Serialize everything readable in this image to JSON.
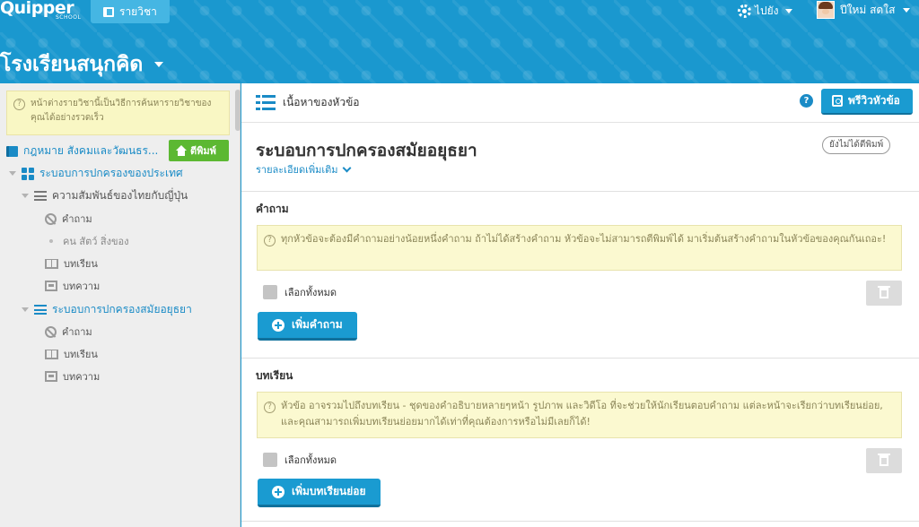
{
  "topnav": {
    "logo": "Quipper",
    "logo_sub": "SCHOOL",
    "subjects_label": "รายวิชา",
    "goto_label": "ไปยัง",
    "user_name": "ปีใหม่ สดใส"
  },
  "school": {
    "name": "โรงเรียนสนุกคิด"
  },
  "sidebar": {
    "notice": "หน้าต่างรายวิชานี้เป็นวิธีการค้นหารายวิชาของคุณได้อย่างรวดเร็ว",
    "course_title": "กฎหมาย สังคมและวัฒนธร...",
    "print_label": "ตีพิมพ์",
    "tree": {
      "chapter": "ระบอบการปกครองของประเทศ",
      "topic1": {
        "label": "ความสัมพันธ์ของไทยกับญี่ปุ่น",
        "items": [
          "คำถาม",
          "คน สัตว์ สิ่งของ",
          "บทเรียน",
          "บทความ"
        ]
      },
      "topic2": {
        "label": "ระบอบการปกครองสมัยอยุธยา",
        "items": [
          "คำถาม",
          "บทเรียน",
          "บทความ"
        ]
      }
    }
  },
  "main": {
    "toolbar_label": "เนื้อหาของหัวข้อ",
    "help_label": "?",
    "preview_label": "พรีวิวหัวข้อ",
    "topic_title": "ระบอบการปกครองสมัยอยุธยา",
    "status_badge": "ยังไม่ได้ตีพิมพ์",
    "more_details": "รายละเอียดเพิ่มเติม",
    "questions": {
      "title": "คำถาม",
      "info": "ทุกหัวข้อจะต้องมีคำถามอย่างน้อยหนึ่งคำถาม ถ้าไม่ได้สร้างคำถาม หัวข้อจะไม่สามารถตีพิมพ์ได้ มาเริ่มต้นสร้างคำถามในหัวข้อของคุณกันเถอะ!",
      "select_all": "เลือกทั้งหมด",
      "add_label": "เพิ่มคำถาม"
    },
    "lessons": {
      "title": "บทเรียน",
      "info": "หัวข้อ อาจรวมไปถึงบทเรียน - ชุดของคำอธิบายหลายๆหน้า รูปภาพ และวิดีโอ ที่จะช่วยให้นักเรียนตอบคำถาม แต่ละหน้าจะเรียกว่าบทเรียนย่อย, และคุณสามารถเพิ่มบทเรียนย่อยมากได้เท่าที่คุณต้องการหรือไม่มีเลยก็ได้!",
      "select_all": "เลือกทั้งหมด",
      "add_label": "เพิ่มบทเรียนย่อย"
    }
  },
  "colors": {
    "brand": "#1a98cf",
    "accent": "#1a8bc6",
    "print_green": "#5cb832",
    "notice_bg": "#fbf9d0"
  },
  "icons": [
    "book-icon",
    "gear-icon",
    "grid-icon",
    "list-icon",
    "ban-icon",
    "open-book-icon",
    "document-icon",
    "home-icon",
    "help-icon",
    "preview-icon",
    "chevron-down-icon",
    "trash-icon",
    "plus-icon"
  ]
}
